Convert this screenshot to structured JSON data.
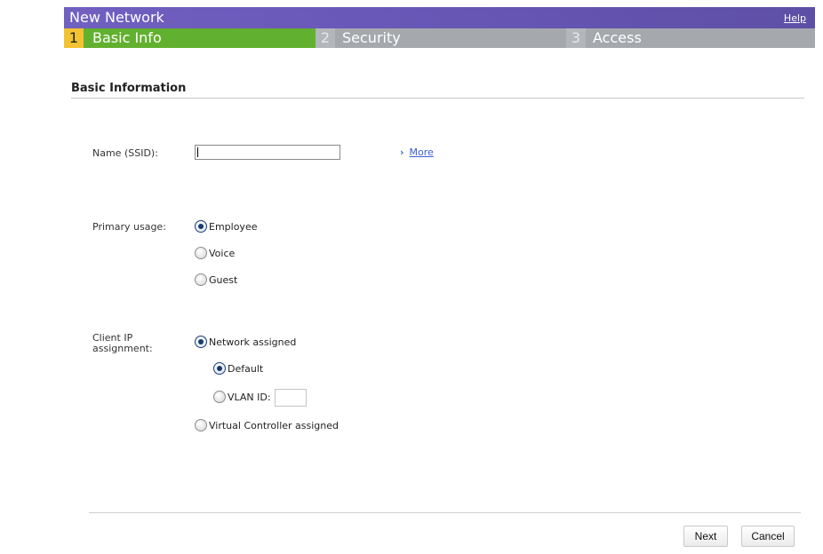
{
  "window": {
    "title": "New Network",
    "help_label": "Help"
  },
  "steps": [
    {
      "num": "1",
      "label": "Basic Info",
      "active": true
    },
    {
      "num": "2",
      "label": "Security",
      "active": false
    },
    {
      "num": "3",
      "label": "Access",
      "active": false
    }
  ],
  "section": {
    "heading": "Basic Information"
  },
  "ssid": {
    "label": "Name (SSID):",
    "value": "",
    "more_label": "More"
  },
  "usage": {
    "label": "Primary usage:",
    "options": [
      {
        "label": "Employee",
        "selected": true
      },
      {
        "label": "Voice",
        "selected": false
      },
      {
        "label": "Guest",
        "selected": false
      }
    ]
  },
  "ip": {
    "label_line1": "Client IP",
    "label_line2": "assignment:",
    "network_assigned": {
      "label": "Network assigned",
      "selected": true
    },
    "default": {
      "label": "Default",
      "selected": true
    },
    "vlan": {
      "label": "VLAN ID:",
      "selected": false,
      "value": ""
    },
    "virtual_controller": {
      "label": "Virtual Controller assigned",
      "selected": false
    }
  },
  "buttons": {
    "next": "Next",
    "cancel": "Cancel"
  },
  "colors": {
    "title_bar": "#6a58b8",
    "active_step": "#62b02f",
    "active_step_number": "#f1c232",
    "inactive_step": "#a5a9ad",
    "link": "#3a5fcd"
  },
  "icons": {
    "more": "chevron-right-icon"
  }
}
